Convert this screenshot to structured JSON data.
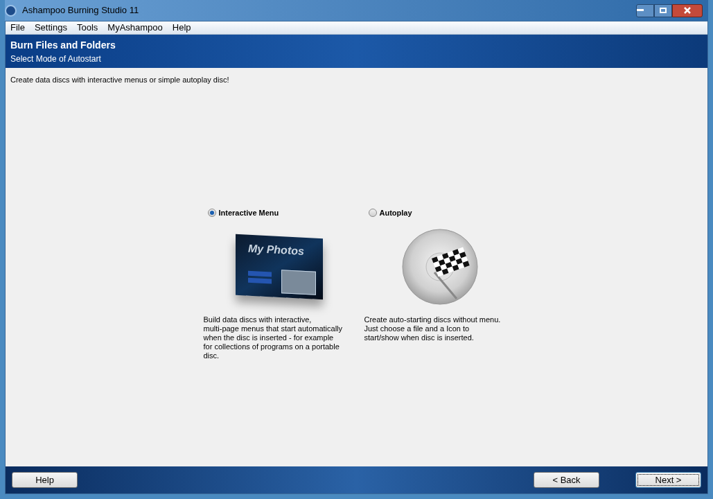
{
  "window": {
    "title": "Ashampoo Burning Studio 11"
  },
  "menu": [
    "File",
    "Settings",
    "Tools",
    "MyAshampoo",
    "Help"
  ],
  "header": {
    "title": "Burn Files and Folders",
    "subtitle": "Select Mode of Autostart"
  },
  "intro": "Create data discs with interactive menus or simple autoplay disc!",
  "options": [
    {
      "kind": "menu",
      "label": "Interactive Menu",
      "selected": true,
      "preview_title": "My Photos",
      "description": "Build data discs with interactive,\nmulti-page menus that start automatically\nwhen the disc is inserted - for example\nfor collections of programs on a portable\ndisc."
    },
    {
      "kind": "autoplay",
      "label": "Autoplay",
      "selected": false,
      "description": "Create auto-starting discs without menu.\nJust choose a file and a Icon to\nstart/show when disc is inserted."
    }
  ],
  "buttons": {
    "help": "Help",
    "back": "< Back",
    "next": "Next >"
  }
}
